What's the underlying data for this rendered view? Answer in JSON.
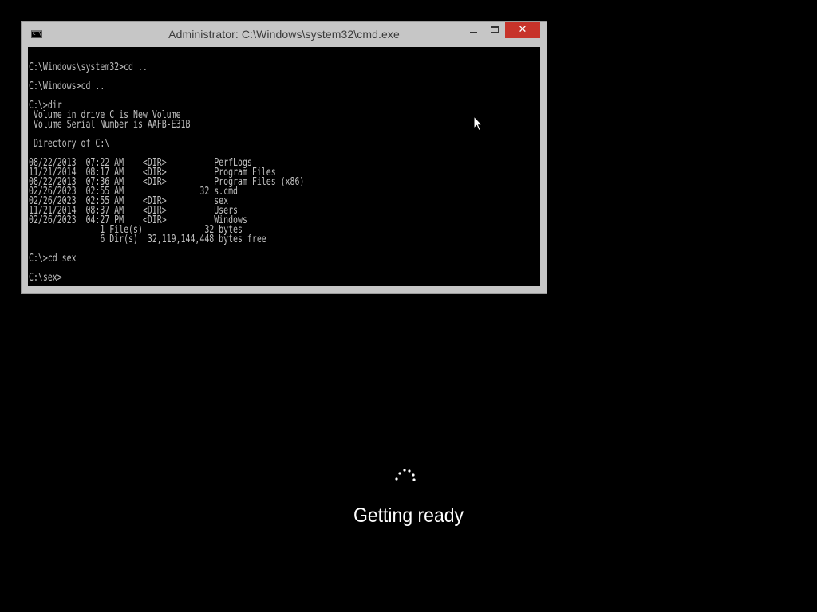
{
  "window": {
    "title": "Administrator: C:\\Windows\\system32\\cmd.exe",
    "icon": "cmd-icon",
    "icon_glyph": "C:\\",
    "controls": {
      "minimize": "minimize-icon",
      "maximize": "maximize-icon",
      "close": "close-icon",
      "close_glyph": "✕",
      "close_color": "#c7332a"
    }
  },
  "console": {
    "text_color": "#c0c0c0",
    "background": "#000000",
    "lines": [
      "C:\\Windows\\system32>cd ..",
      "",
      "C:\\Windows>cd ..",
      "",
      "C:\\>dir",
      " Volume in drive C is New Volume",
      " Volume Serial Number is AAFB-E31B",
      "",
      " Directory of C:\\",
      "",
      "08/22/2013  07:22 AM    <DIR>          PerfLogs",
      "11/21/2014  08:17 AM    <DIR>          Program Files",
      "08/22/2013  07:36 AM    <DIR>          Program Files (x86)",
      "02/26/2023  02:55 AM                32 s.cmd",
      "02/26/2023  02:55 AM    <DIR>          sex",
      "11/21/2014  08:37 AM    <DIR>          Users",
      "02/26/2023  04:27 PM    <DIR>          Windows",
      "               1 File(s)             32 bytes",
      "               6 Dir(s)  32,119,144,448 bytes free",
      "",
      "C:\\>cd sex",
      "",
      "C:\\sex>"
    ]
  },
  "setup": {
    "status": "Getting ready",
    "spinner_icon": "loading-spinner-icon"
  },
  "cursor": {
    "icon": "mouse-pointer-icon"
  }
}
